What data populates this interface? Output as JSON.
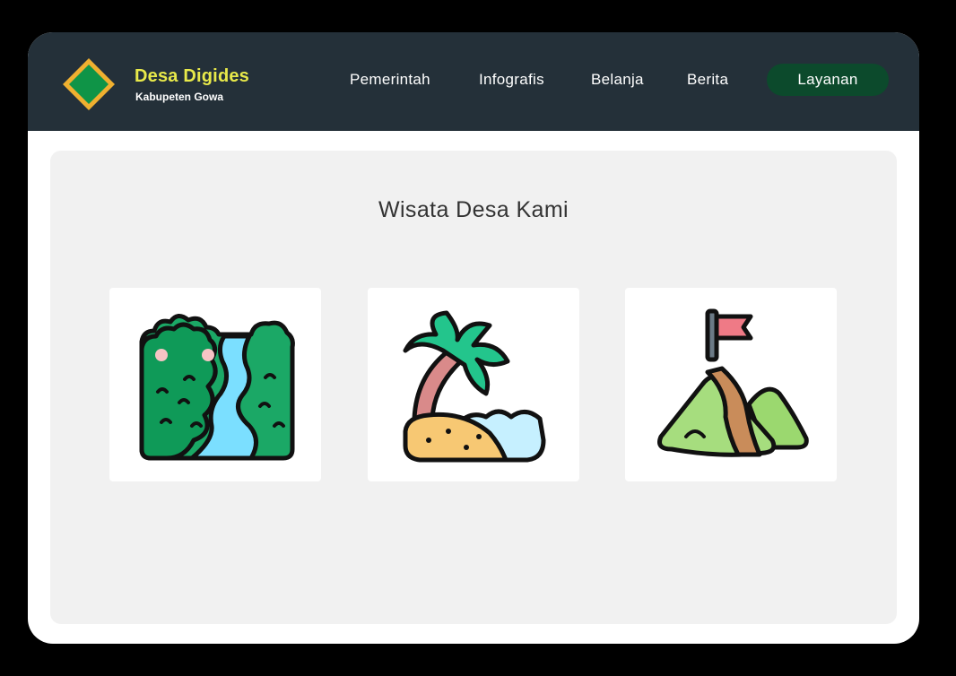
{
  "header": {
    "brand_title": "Desa Digides",
    "brand_subtitle": "Kabupeten Gowa",
    "nav": [
      "Pemerintah",
      "Infografis",
      "Belanja",
      "Berita"
    ],
    "cta_label": "Layanan"
  },
  "main": {
    "section_title": "Wisata Desa Kami",
    "cards": [
      {
        "icon": "forest-river-icon"
      },
      {
        "icon": "palm-beach-icon"
      },
      {
        "icon": "mountain-flag-icon"
      }
    ]
  },
  "colors": {
    "navbar_bg": "#243039",
    "brand_title": "#e8e94a",
    "cta_bg": "#0c4a2c",
    "logo_green": "#0f9447",
    "logo_border": "#f0b030",
    "panel_bg": "#f1f1f1"
  }
}
